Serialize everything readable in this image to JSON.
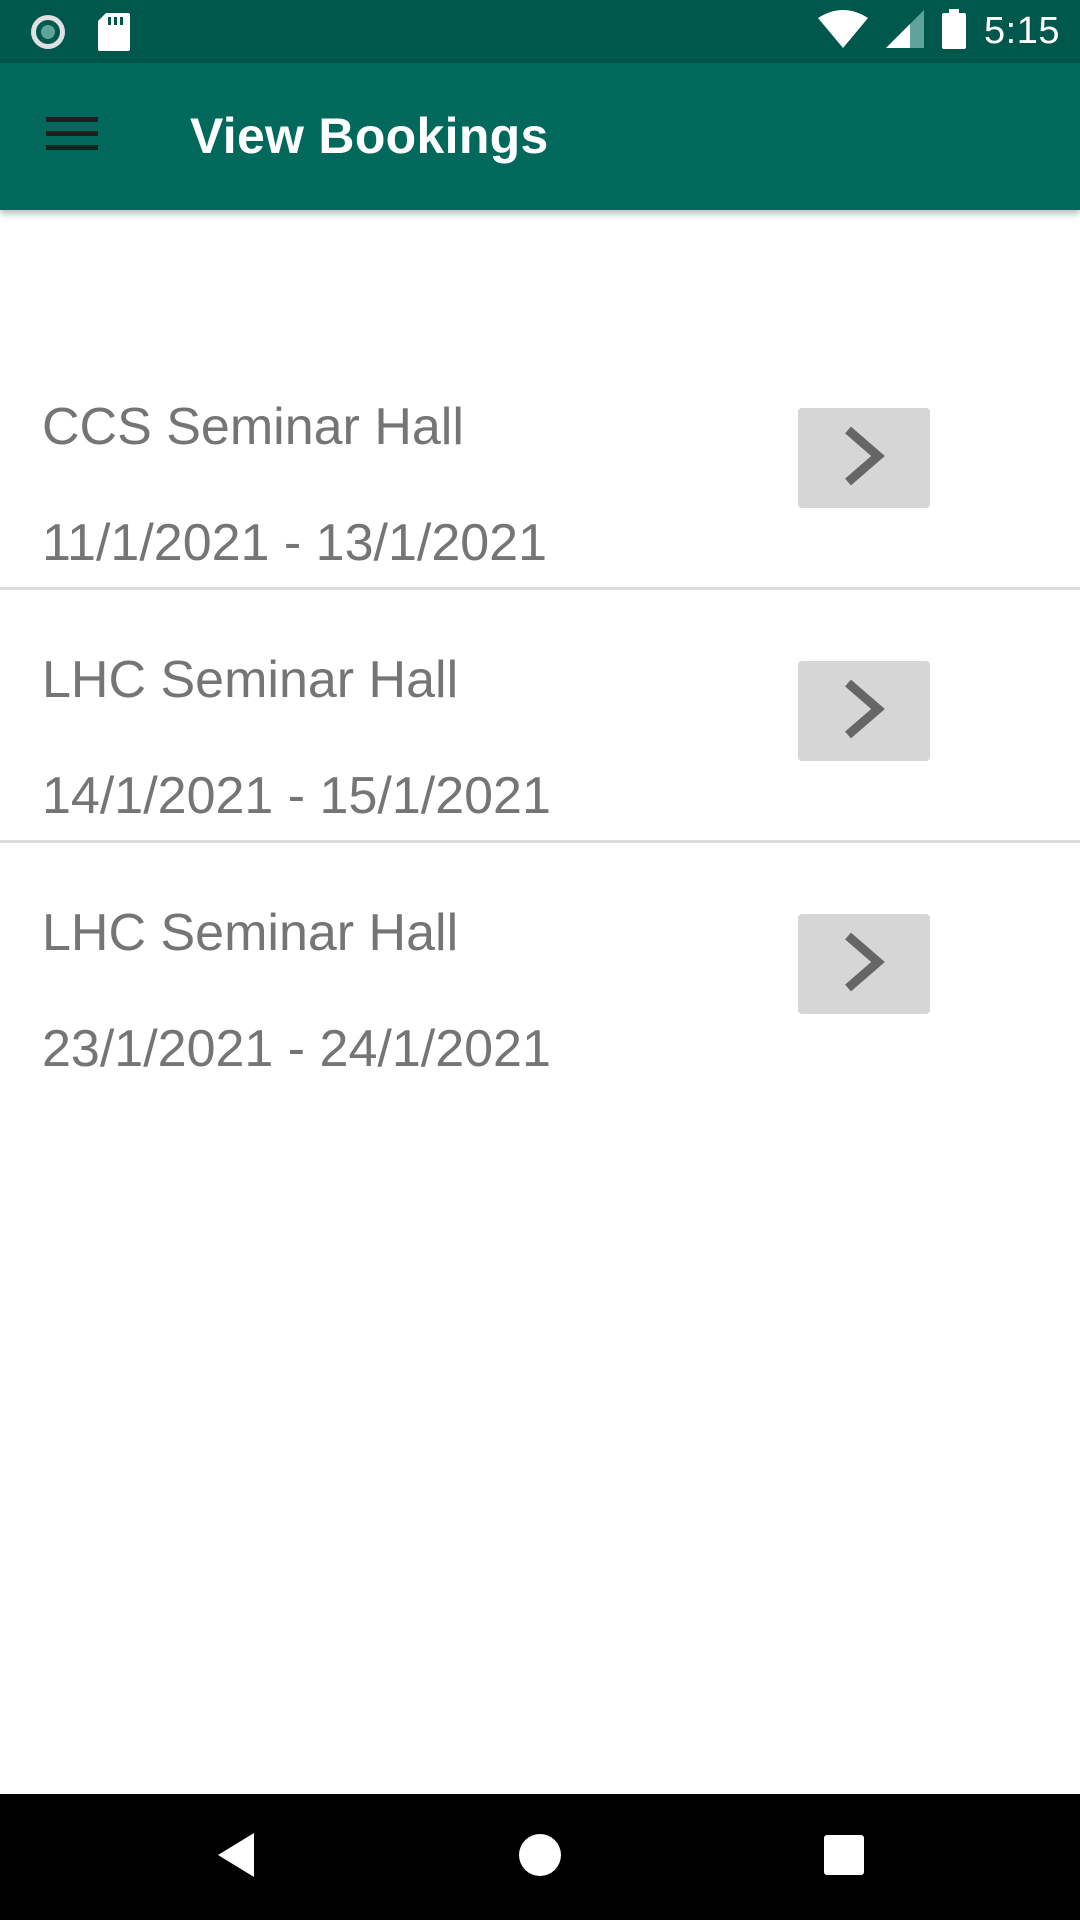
{
  "status_bar": {
    "time": "5:15",
    "icons": [
      "radio-icon",
      "sd-card-icon",
      "wifi-icon",
      "signal-icon",
      "battery-icon"
    ]
  },
  "app_bar": {
    "title": "View Bookings",
    "menu_icon": "hamburger-menu-icon"
  },
  "bookings": [
    {
      "name": "CCS Seminar Hall",
      "dates": "11/1/2021 - 13/1/2021",
      "action_icon": "chevron-right-icon"
    },
    {
      "name": "LHC Seminar Hall",
      "dates": "14/1/2021 - 15/1/2021",
      "action_icon": "chevron-right-icon"
    },
    {
      "name": "LHC Seminar Hall",
      "dates": "23/1/2021 - 24/1/2021",
      "action_icon": "chevron-right-icon"
    }
  ],
  "nav_bar": {
    "buttons": [
      "back-icon",
      "home-icon",
      "recents-icon"
    ]
  },
  "colors": {
    "status_bar": "#00574b",
    "app_bar": "#00695c",
    "text_secondary": "#757575",
    "button_bg": "#d6d6d6",
    "divider": "#dcdcdc"
  }
}
